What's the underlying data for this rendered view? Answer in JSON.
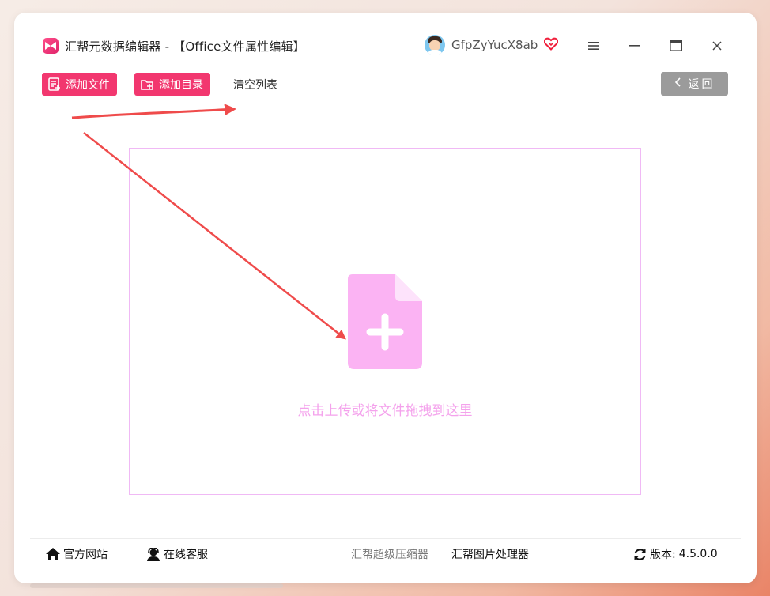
{
  "window": {
    "title": "汇帮元数据编辑器 - 【Office文件属性编辑】",
    "username": "GfpZyYucX8ab"
  },
  "toolbar": {
    "add_file": "添加文件",
    "add_dir": "添加目录",
    "clear_list": "清空列表",
    "back": "返回"
  },
  "dropzone": {
    "hint": "点击上传或将文件拖拽到这里"
  },
  "footer": {
    "website": "官方网站",
    "support": "在线客服",
    "compressor": "汇帮超级压缩器",
    "image_tool": "汇帮图片处理器",
    "version_label": "版本:",
    "version": "4.5.0.0"
  },
  "colors": {
    "accent": "#f2376f",
    "dropzone_icon": "#fbb3f3",
    "dropzone_text": "#f4a2ec",
    "arrow": "#ef4b4b"
  },
  "icons": [
    "app-logo-icon",
    "vip-heart-icon",
    "menu-icon",
    "minimize-icon",
    "maximize-icon",
    "close-icon",
    "add-file-icon",
    "add-folder-icon",
    "chevron-left-icon",
    "file-plus-icon",
    "home-icon",
    "support-icon",
    "refresh-icon"
  ]
}
